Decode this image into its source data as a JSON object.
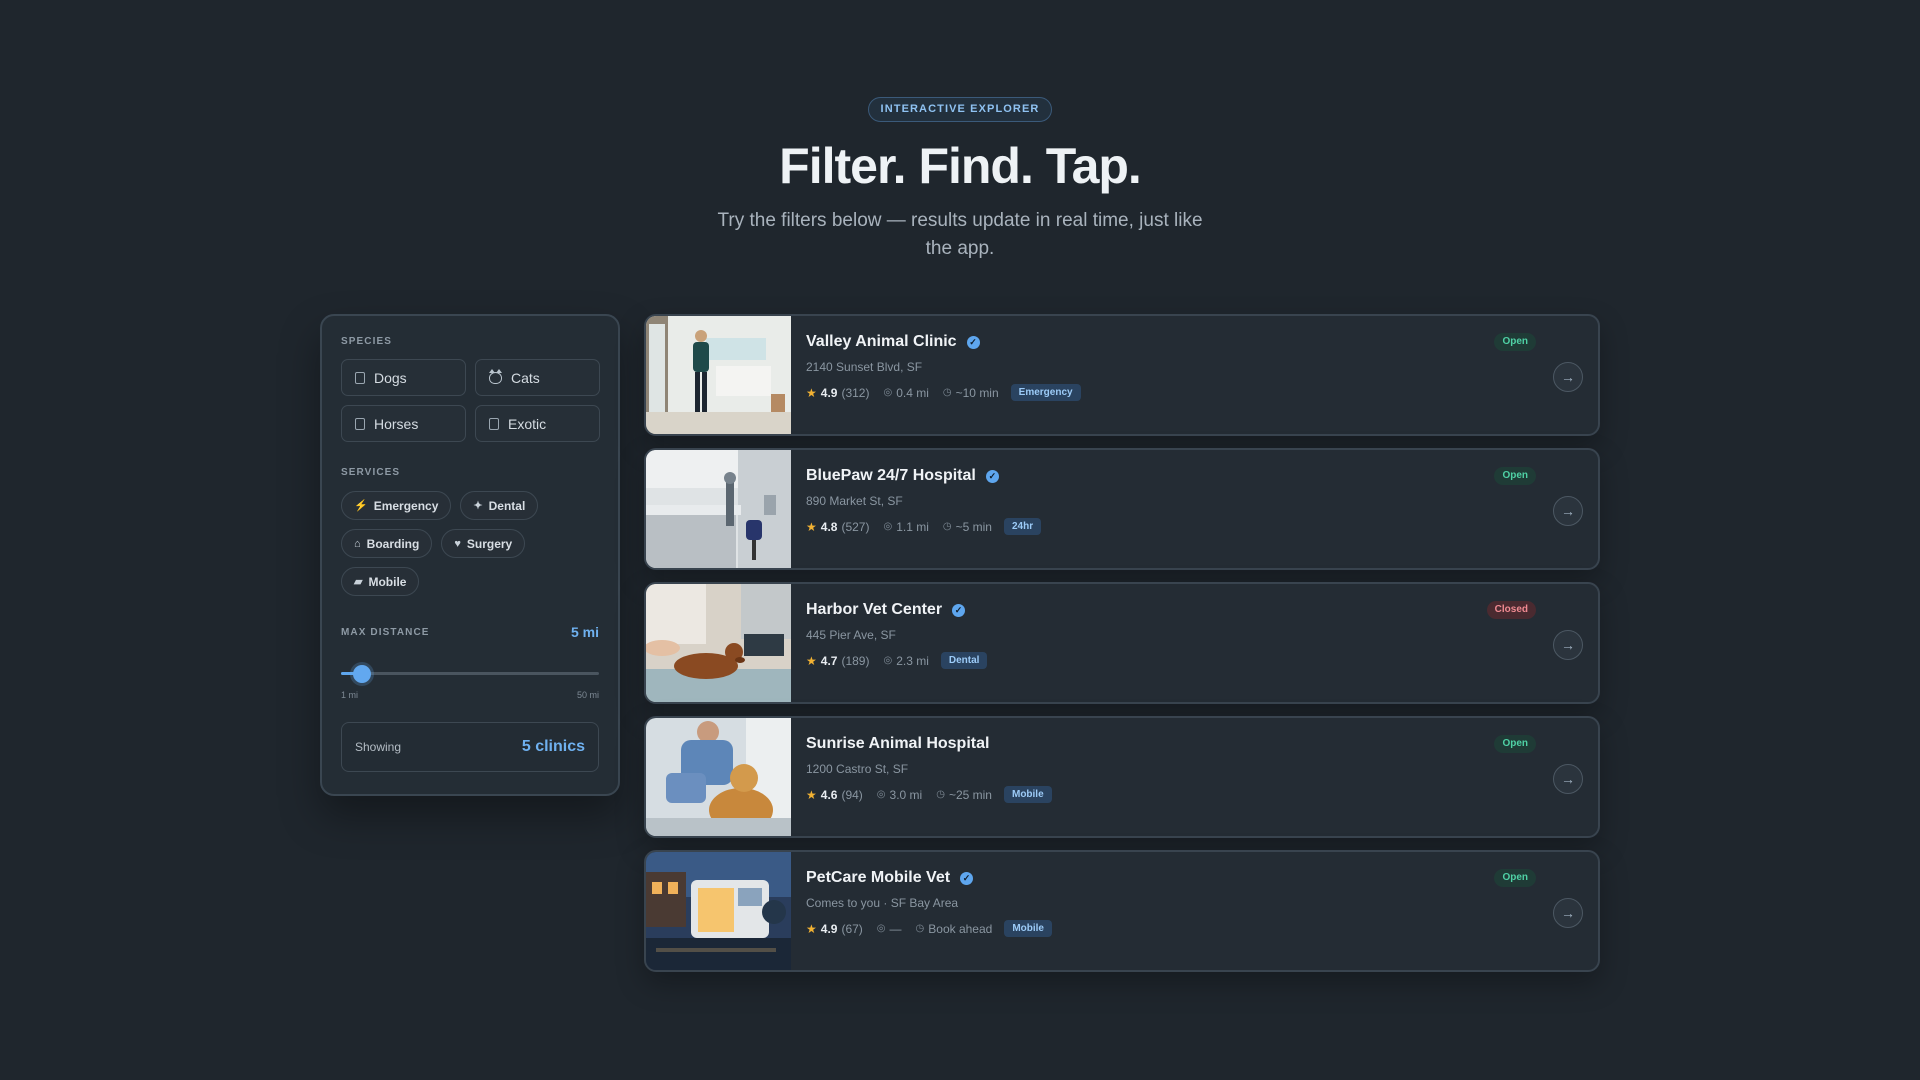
{
  "hero": {
    "eyebrow": "INTERACTIVE EXPLORER",
    "headline": "Filter. Find. Tap.",
    "subtitle": "Try the filters below — results update in real time, just like the app."
  },
  "filters": {
    "species_label": "SPECIES",
    "species": [
      {
        "label": "Dogs",
        "icon": "dog-icon"
      },
      {
        "label": "Cats",
        "icon": "cat-icon"
      },
      {
        "label": "Horses",
        "icon": "horse-icon"
      },
      {
        "label": "Exotic",
        "icon": "exotic-icon"
      }
    ],
    "services_label": "SERVICES",
    "services": [
      {
        "label": "Emergency",
        "icon": "bolt-icon"
      },
      {
        "label": "Dental",
        "icon": "sparkle-icon"
      },
      {
        "label": "Boarding",
        "icon": "home-icon"
      },
      {
        "label": "Surgery",
        "icon": "heart-icon"
      },
      {
        "label": "Mobile",
        "icon": "van-icon"
      }
    ],
    "distance_label": "MAX DISTANCE",
    "distance_value": "5 mi",
    "distance_fraction": 0.082,
    "distance_min": "1 mi",
    "distance_max": "50 mi",
    "showing_label": "Showing",
    "showing_count": "5 clinics"
  },
  "clinics": [
    {
      "name": "Valley Animal Clinic",
      "address": "2140 Sunset Blvd, SF",
      "rating": "4.9",
      "reviews": "(312)",
      "distance": "0.4 mi",
      "time": "~10 min",
      "tag": "Emergency",
      "status": "Open"
    },
    {
      "name": "BluePaw 24/7 Hospital",
      "address": "890 Market St, SF",
      "rating": "4.8",
      "reviews": "(527)",
      "distance": "1.1 mi",
      "time": "~5 min",
      "tag": "24hr",
      "status": "Open"
    },
    {
      "name": "Harbor Vet Center",
      "address": "445 Pier Ave, SF",
      "rating": "4.7",
      "reviews": "(189)",
      "distance": "2.3 mi",
      "time": "",
      "tag": "Dental",
      "status": "Closed"
    },
    {
      "name": "Sunrise Animal Hospital",
      "address": "1200 Castro St, SF",
      "rating": "4.6",
      "reviews": "(94)",
      "distance": "3.0 mi",
      "time": "~25 min",
      "tag": "Mobile",
      "status": "Open"
    },
    {
      "name": "PetCare Mobile Vet",
      "address": "Comes to you · SF Bay Area",
      "rating": "4.9",
      "reviews": "(67)",
      "distance": "—",
      "time": "Book ahead",
      "tag": "Mobile",
      "status": "Open"
    }
  ],
  "colors": {
    "accent": "#5ea6ee",
    "open": "#4fd1a5",
    "closed": "#f08a92",
    "background": "#1f262d"
  }
}
